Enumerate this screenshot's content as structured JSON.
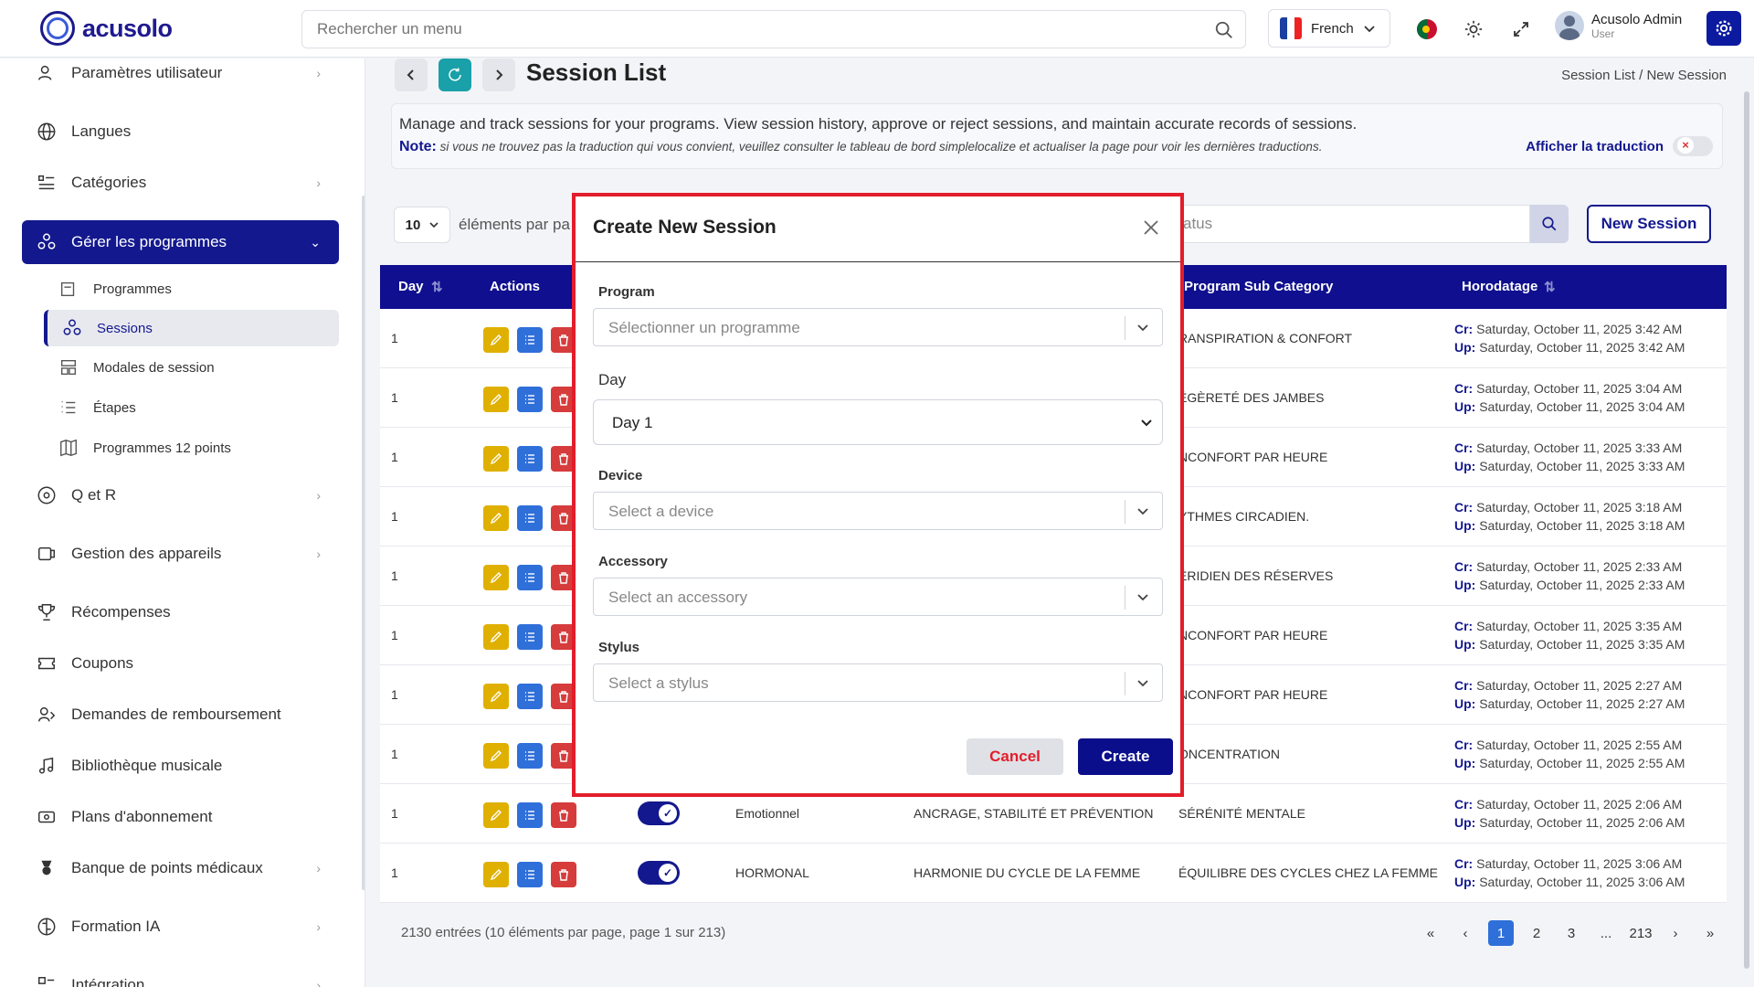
{
  "app": {
    "logo_text": "acusolo"
  },
  "header": {
    "search_placeholder": "Rechercher un menu",
    "language": "French",
    "user_name": "Acusolo Admin",
    "user_role": "User"
  },
  "sidebar": {
    "items": [
      {
        "label": "Paramètres utilisateur",
        "icon": "user-settings-icon"
      },
      {
        "label": "Langues",
        "icon": "globe-icon"
      },
      {
        "label": "Catégories",
        "icon": "list-icon"
      },
      {
        "label": "Gérer les programmes",
        "icon": "program-icon"
      },
      {
        "label": "Q et R",
        "icon": "qa-icon"
      },
      {
        "label": "Gestion des appareils",
        "icon": "device-icon"
      },
      {
        "label": "Récompenses",
        "icon": "trophy-icon"
      },
      {
        "label": "Coupons",
        "icon": "coupon-icon"
      },
      {
        "label": "Demandes de remboursement",
        "icon": "refund-icon"
      },
      {
        "label": "Bibliothèque musicale",
        "icon": "music-icon"
      },
      {
        "label": "Plans d'abonnement",
        "icon": "subscription-icon"
      },
      {
        "label": "Banque de points médicaux",
        "icon": "medal-icon"
      },
      {
        "label": "Formation IA",
        "icon": "brain-icon"
      },
      {
        "label": "Intégration",
        "icon": "integration-icon"
      }
    ],
    "sub_items": [
      {
        "label": "Programmes"
      },
      {
        "label": "Sessions"
      },
      {
        "label": "Modales de session"
      },
      {
        "label": "Étapes"
      },
      {
        "label": "Programmes 12 points"
      }
    ]
  },
  "page": {
    "title": "Session List",
    "breadcrumb": "Session List  /  New Session",
    "info_text": "Manage and track sessions for your programs. View session history, approve or reject sessions, and maintain accurate records of sessions.",
    "note_label": "Note:",
    "note_text": "si vous ne trouvez pas la traduction qui vous convient, veuillez consulter le tableau de bord simplelocalize et actualiser la page pour voir les dernières traductions.",
    "translation_toggle": "Afficher la traduction",
    "per_page": "10",
    "per_page_label": "éléments par pa",
    "filter_placeholder": "atus",
    "new_session": "New Session"
  },
  "table": {
    "headers": {
      "day": "Day",
      "actions": "Actions",
      "sub_category": "Program Sub Category",
      "timestamp": "Horodatage"
    },
    "rows": [
      {
        "day": "1",
        "col1": "",
        "col2": "",
        "sub": "RANSPIRATION & CONFORT",
        "cr": "Saturday, October 11, 2025 3:42 AM",
        "up": "Saturday, October 11, 2025 3:42 AM"
      },
      {
        "day": "1",
        "col1": "",
        "col2": "",
        "sub": "ÉGÈRETÉ DES JAMBES",
        "cr": "Saturday, October 11, 2025 3:04 AM",
        "up": "Saturday, October 11, 2025 3:04 AM"
      },
      {
        "day": "1",
        "col1": "",
        "col2": "",
        "sub": "NCONFORT PAR HEURE",
        "cr": "Saturday, October 11, 2025 3:33 AM",
        "up": "Saturday, October 11, 2025 3:33 AM"
      },
      {
        "day": "1",
        "col1": "",
        "col2": "",
        "sub": "YTHMES CIRCADIEN.",
        "cr": "Saturday, October 11, 2025 3:18 AM",
        "up": "Saturday, October 11, 2025 3:18 AM"
      },
      {
        "day": "1",
        "col1": "",
        "col2": "",
        "sub": "ÉRIDIEN DES RÉSERVES",
        "cr": "Saturday, October 11, 2025 2:33 AM",
        "up": "Saturday, October 11, 2025 2:33 AM"
      },
      {
        "day": "1",
        "col1": "",
        "col2": "",
        "sub": "NCONFORT PAR HEURE",
        "cr": "Saturday, October 11, 2025 3:35 AM",
        "up": "Saturday, October 11, 2025 3:35 AM"
      },
      {
        "day": "1",
        "col1": "",
        "col2": "",
        "sub": "NCONFORT PAR HEURE",
        "cr": "Saturday, October 11, 2025 2:27 AM",
        "up": "Saturday, October 11, 2025 2:27 AM"
      },
      {
        "day": "1",
        "col1": "",
        "col2": "",
        "sub": "ONCENTRATION",
        "cr": "Saturday, October 11, 2025 2:55 AM",
        "up": "Saturday, October 11, 2025 2:55 AM"
      },
      {
        "day": "1",
        "col1": "Emotionnel",
        "col2": "ANCRAGE, STABILITÉ ET PRÉVENTION",
        "sub": "SÉRÉNITÉ MENTALE",
        "cr": "Saturday, October 11, 2025 2:06 AM",
        "up": "Saturday, October 11, 2025 2:06 AM"
      },
      {
        "day": "1",
        "col1": "HORMONAL",
        "col2": "HARMONIE DU CYCLE DE LA FEMME",
        "sub": "ÉQUILIBRE DES CYCLES CHEZ LA FEMME",
        "cr": "Saturday, October 11, 2025 3:06 AM",
        "up": "Saturday, October 11, 2025 3:06 AM"
      }
    ],
    "cr_label": "Cr:",
    "up_label": "Up:"
  },
  "footer": {
    "count": "2130 entrées (10 éléments par page, page 1 sur 213)",
    "pages": [
      "«",
      "‹",
      "1",
      "2",
      "3",
      "...",
      "213",
      "›",
      "»"
    ]
  },
  "modal": {
    "title": "Create New Session",
    "program_label": "Program",
    "program_placeholder": "Sélectionner un programme",
    "day_label": "Day",
    "day_value": "Day 1",
    "device_label": "Device",
    "device_placeholder": "Select a device",
    "accessory_label": "Accessory",
    "accessory_placeholder": "Select an accessory",
    "stylus_label": "Stylus",
    "stylus_placeholder": "Select a stylus",
    "cancel": "Cancel",
    "create": "Create"
  },
  "colors": {
    "brand": "#13188e",
    "modal_border": "#e31d2b"
  }
}
